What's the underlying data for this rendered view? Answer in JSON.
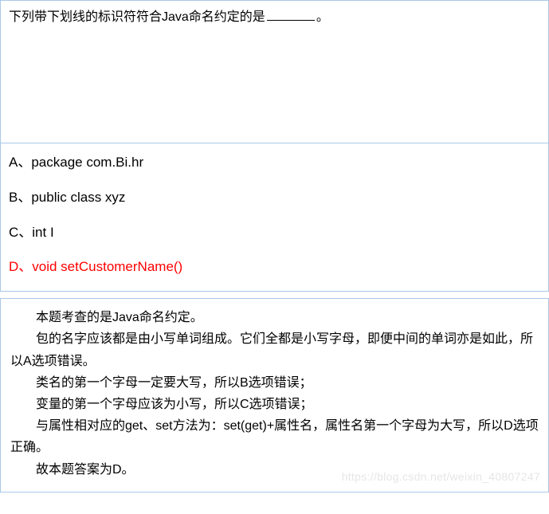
{
  "question": {
    "prefix": "下列带下划线的标识符符合Java命名约定的是",
    "suffix": "。"
  },
  "options": {
    "a": "A、package com.Bi.hr",
    "b": "B、public class xyz",
    "c": "C、int I",
    "d": "D、void setCustomerName()"
  },
  "explanation": {
    "line1": "本题考查的是Java命名约定。",
    "line2": "包的名字应该都是由小写单词组成。它们全都是小写字母，即便中间的单词亦是如此，所以A选项错误。",
    "line3": "类名的第一个字母一定要大写，所以B选项错误；",
    "line4": "变量的第一个字母应该为小写，所以C选项错误；",
    "line5": "与属性相对应的get、set方法为：set(get)+属性名，属性名第一个字母为大写，所以D选项正确。",
    "line6": "故本题答案为D。"
  },
  "watermark": "https://blog.csdn.net/weixin_40807247"
}
